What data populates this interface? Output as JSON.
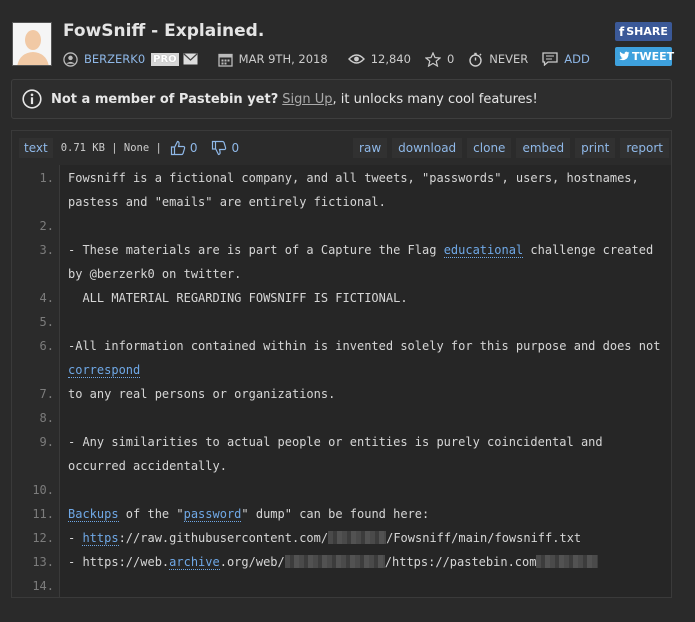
{
  "paste": {
    "title": "FowSniff - Explained.",
    "author": "BERZERK0",
    "pro_badge": "PRO",
    "date": "MAR 9TH, 2018",
    "views": "12,840",
    "rating": "0",
    "expiry": "NEVER",
    "comment_label": "ADD"
  },
  "social": {
    "share": "SHARE",
    "tweet": "TWEET",
    "share_color": "#3b5998",
    "tweet_color": "#3ea1dd"
  },
  "notice": {
    "lead": "Not a member of Pastebin yet?",
    "link": "Sign Up",
    "rest": ", it unlocks many cool features!"
  },
  "toolbar": {
    "syntax": "text",
    "size": "0.71 KB | None |",
    "likes": "0",
    "dislikes": "0",
    "actions": [
      "raw",
      "download",
      "clone",
      "embed",
      "print",
      "report"
    ]
  },
  "lines": [
    {
      "n": "1.",
      "t1": "Fowsniff is a fictional company, and all tweets, \"passwords\", users, hostnames,",
      "t2": "pastess and \"emails\" are entirely fictional."
    },
    {
      "n": "2.",
      "t1": ""
    },
    {
      "n": "3.",
      "a": "- These materials are is part of a Capture the Flag ",
      "link": "educational",
      "b": " challenge created",
      "t2": "by @berzerk0 on twitter."
    },
    {
      "n": "4.",
      "t1": "  ALL MATERIAL REGARDING FOWSNIFF IS FICTIONAL."
    },
    {
      "n": "5.",
      "t1": ""
    },
    {
      "n": "6.",
      "t1": "-All information contained within is invented solely for this purpose and does not",
      "link2": "correspond"
    },
    {
      "n": "7.",
      "t1": "to any real persons or organizations."
    },
    {
      "n": "8.",
      "t1": ""
    },
    {
      "n": "9.",
      "t1": "- Any similarities to actual people or entities is purely coincidental and",
      "t2": "occurred accidentally."
    },
    {
      "n": "10.",
      "t1": ""
    },
    {
      "n": "11.",
      "link": "Backups",
      "a": " of the \"",
      "link2": "password",
      "b": "\" dump\" can be found here:"
    },
    {
      "n": "12.",
      "a": "- ",
      "link": "https",
      "b": "://raw.githubusercontent.com/",
      "c": "/Fowsniff/main/fowsniff.txt"
    },
    {
      "n": "13.",
      "a": "- https://web.",
      "link": "archive",
      "b": ".org/web/",
      "c": "/https://pastebin.com"
    },
    {
      "n": "14.",
      "t1": ""
    }
  ]
}
